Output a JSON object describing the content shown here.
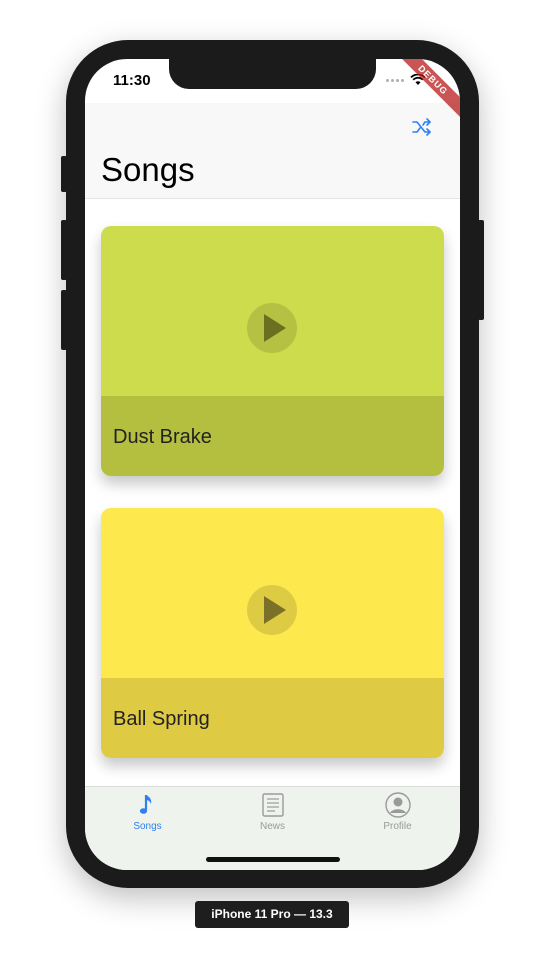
{
  "status_bar": {
    "time": "11:30"
  },
  "debug_banner": {
    "text": "DEBUG"
  },
  "nav": {
    "title": "Songs",
    "shuffle_icon": "shuffle-icon",
    "accent": "#2f80ed"
  },
  "songs": [
    {
      "title": "Dust Brake",
      "top_color": "#cddc4c",
      "bottom_color": "#b4bf40",
      "icon": "play-icon"
    },
    {
      "title": "Ball Spring",
      "top_color": "#fde84e",
      "bottom_color": "#dfca43",
      "icon": "play-icon"
    }
  ],
  "tabs": [
    {
      "label": "Songs",
      "icon": "music-note-icon",
      "active": true
    },
    {
      "label": "News",
      "icon": "news-icon",
      "active": false
    },
    {
      "label": "Profile",
      "icon": "profile-icon",
      "active": false
    }
  ],
  "colors": {
    "tab_active": "#2f80ed",
    "tab_inactive": "#9a9a9a"
  },
  "device": {
    "label": "iPhone 11 Pro — 13.3"
  }
}
